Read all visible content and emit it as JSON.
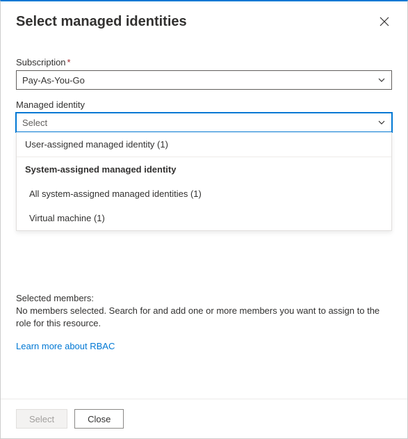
{
  "title": "Select managed identities",
  "subscription": {
    "label": "Subscription",
    "value": "Pay-As-You-Go"
  },
  "managedIdentity": {
    "label": "Managed identity",
    "placeholder": "Select",
    "dropdown": {
      "userAssigned": "User-assigned managed identity (1)",
      "systemHeader": "System-assigned managed identity",
      "allSystem": "All system-assigned managed identities (1)",
      "vm": "Virtual machine (1)"
    }
  },
  "selected": {
    "label": "Selected members:",
    "message": "No members selected. Search for and add one or more members you want to assign to the role for this resource."
  },
  "learnMore": "Learn more about RBAC",
  "footer": {
    "select": "Select",
    "close": "Close"
  }
}
